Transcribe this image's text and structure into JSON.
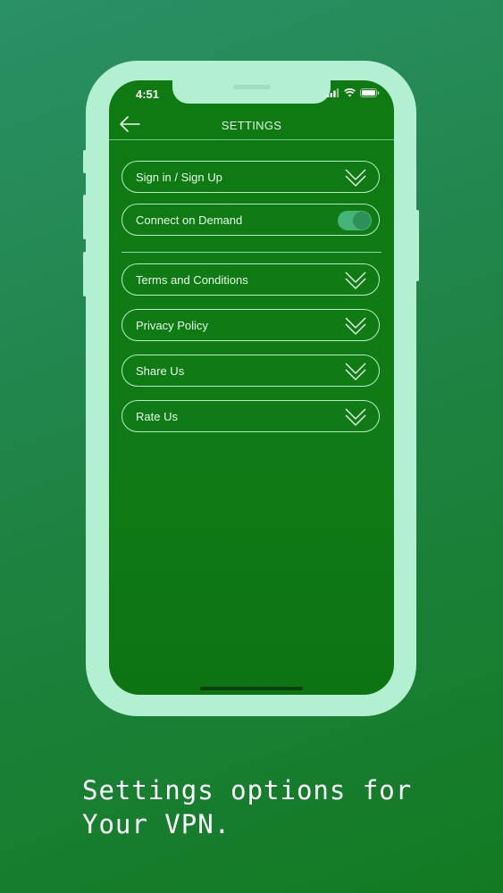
{
  "status_bar": {
    "time": "4:51",
    "icons": [
      "signal-icon",
      "wifi-icon",
      "battery-icon"
    ]
  },
  "header": {
    "title": "SETTINGS",
    "back_icon": "back-arrow-icon"
  },
  "settings": {
    "sign_in": "Sign in / Sign Up",
    "connect_on_demand": "Connect on Demand",
    "connect_on_demand_enabled": true,
    "terms": "Terms and Conditions",
    "privacy": "Privacy Policy",
    "share": "Share Us",
    "rate": "Rate Us",
    "expand_icon": "double-chevron-down-icon"
  },
  "caption": {
    "line1": "Settings options for",
    "line2": "Your VPN."
  },
  "colors": {
    "background": "#1f8446",
    "phone_frame": "#b3f0d2",
    "screen": "#107b16",
    "toggle_on": "#46b476"
  }
}
